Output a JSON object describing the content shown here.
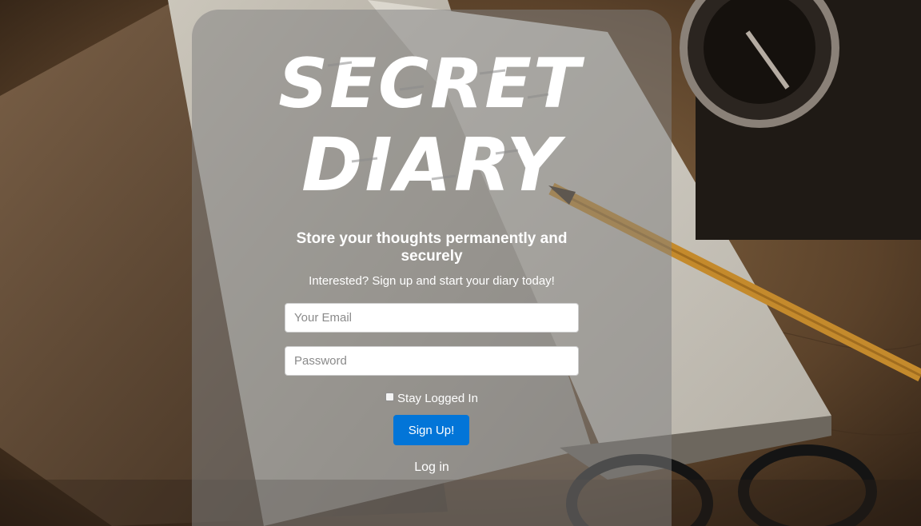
{
  "app": {
    "logo_line1": "SECRET",
    "logo_line2": "DIARY",
    "tagline": "Store your thoughts permanently and securely",
    "subtagline": "Interested? Sign up and start your diary today!"
  },
  "form": {
    "email_placeholder": "Your Email",
    "email_value": "",
    "password_placeholder": "Password",
    "password_value": "",
    "stay_logged_in_label": "Stay Logged In",
    "stay_logged_in_checked": false,
    "signup_label": "Sign Up!",
    "login_link_label": "Log in"
  },
  "colors": {
    "button_primary": "#0275d8",
    "panel_overlay": "rgba(128,128,128,0.52)",
    "text": "#ffffff"
  }
}
